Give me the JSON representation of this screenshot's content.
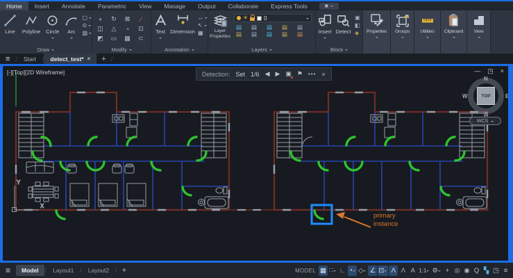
{
  "colors": {
    "accent": "#1b6ee8",
    "hl": "#1f8cff",
    "green": "#2fc32f",
    "wall": "#6e2e26",
    "blue": "#2744ae",
    "orange": "#d9782a",
    "gray": "#98a0a9"
  },
  "menu": {
    "tabs": [
      {
        "name": "tab-home",
        "label": "Home",
        "active": true
      },
      {
        "name": "tab-insert",
        "label": "Insert"
      },
      {
        "name": "tab-annotate",
        "label": "Annotate"
      },
      {
        "name": "tab-parametric",
        "label": "Parametric"
      },
      {
        "name": "tab-view",
        "label": "View"
      },
      {
        "name": "tab-manage",
        "label": "Manage"
      },
      {
        "name": "tab-output",
        "label": "Output"
      },
      {
        "name": "tab-collaborate",
        "label": "Collaborate"
      },
      {
        "name": "tab-express-tools",
        "label": "Express Tools"
      }
    ]
  },
  "ribbon": {
    "draw": {
      "label": "Draw",
      "line": "Line",
      "polyline": "Polyline",
      "circle": "Circle",
      "arc": "Arc",
      "small_icons": [
        {
          "name": "rectangle-tool-icon",
          "glyph": "▢",
          "caret": true
        },
        {
          "name": "ellipse-tool-icon",
          "glyph": "⊙",
          "caret": true
        },
        {
          "name": "hatch-tool-icon",
          "glyph": "▨",
          "caret": true
        }
      ]
    },
    "modify": {
      "label": "Modify",
      "grid": [
        {
          "name": "move-icon",
          "glyph": "+"
        },
        {
          "name": "rotate-icon",
          "glyph": "↻"
        },
        {
          "name": "trim-icon",
          "glyph": "⊠"
        },
        {
          "name": "erase-icon",
          "glyph": "∕",
          "color": "#e06a6a"
        },
        {
          "name": "copy-icon",
          "glyph": "◫"
        },
        {
          "name": "mirror-icon",
          "glyph": "△"
        },
        {
          "name": "fillet-icon",
          "glyph": "◔"
        },
        {
          "name": "explode-icon",
          "glyph": "⊡"
        },
        {
          "name": "stretch-icon",
          "glyph": "◩"
        },
        {
          "name": "scale-icon",
          "glyph": "▭"
        },
        {
          "name": "array-icon",
          "glyph": "▦"
        },
        {
          "name": "offset-icon",
          "glyph": "⊂"
        }
      ]
    },
    "annotation": {
      "label": "Annotation",
      "text": "Text",
      "dimension": "Dimension",
      "side_icons": [
        {
          "name": "dim-linear-icon",
          "glyph": "↔",
          "caret": true
        },
        {
          "name": "leader-icon",
          "glyph": "↖",
          "caret": true
        },
        {
          "name": "table-icon",
          "glyph": "▦"
        }
      ]
    },
    "layers": {
      "label": "Layers",
      "layer_properties_1": "Layer",
      "layer_properties_2": "Properties",
      "current_layer": "0",
      "grid": [
        {
          "name": "layer-state-icon",
          "glyph": "▤",
          "color": "#53b7dc"
        },
        {
          "name": "layer-state-icon",
          "glyph": "▤",
          "color": "#9fb3c8"
        },
        {
          "name": "layer-state-icon",
          "glyph": "▤",
          "color": "#53b7dc"
        },
        {
          "name": "layer-state-icon",
          "glyph": "▤",
          "color": "#cbb25a"
        },
        {
          "name": "layer-state-icon",
          "glyph": "▤",
          "color": "#9fb3c8"
        },
        {
          "name": "layer-state-icon",
          "glyph": "▤",
          "color": "#cbb25a"
        },
        {
          "name": "layer-state-icon",
          "glyph": "▤",
          "color": "#9fb3c8"
        },
        {
          "name": "layer-state-icon",
          "glyph": "▤",
          "color": "#53b7dc"
        },
        {
          "name": "layer-state-icon",
          "glyph": "▤",
          "color": "#cbb25a"
        },
        {
          "name": "layer-state-icon",
          "glyph": "▤",
          "color": "#d98a5a"
        }
      ]
    },
    "block": {
      "label": "Block",
      "insert": "Insert",
      "detect": "Detect",
      "side_icons": [
        {
          "name": "block-create-icon",
          "glyph": "▣",
          "color": "#9fb3c8"
        },
        {
          "name": "block-attributes-icon",
          "glyph": "◧",
          "color": "#9fb3c8"
        },
        {
          "name": "block-sync-icon",
          "glyph": "◈",
          "color": "#cbb25a"
        }
      ]
    },
    "single_panels_labels": {
      "properties": "Properties",
      "groups": "Groups",
      "utilities": "Utilities",
      "clipboard": "Clipboard",
      "view": "View"
    }
  },
  "file_tabs": {
    "start": "Start",
    "document": "detect_test*"
  },
  "viewport": {
    "label": "[-][Top][2D Wireframe]",
    "detection": {
      "title": "Detection:",
      "set": "Set",
      "count": "1/6"
    },
    "viewcube": {
      "n": "N",
      "w": "W",
      "e": "E",
      "s": "S",
      "top": "TOP",
      "wcs": "WCS"
    },
    "callout": {
      "line1": "primary",
      "line2": "instance"
    },
    "ucs": {
      "x": "X",
      "y": "Y"
    }
  },
  "layout_tabs": {
    "model": "Model",
    "layout1": "Layout1",
    "layout2": "Layout2"
  },
  "status": {
    "model": "MODEL",
    "icons": [
      {
        "name": "grid-display-icon",
        "glyph": "▦",
        "active": true
      },
      {
        "name": "snap-mode-icon",
        "glyph": "∷",
        "caret": true
      },
      {
        "name": "ortho-mode-icon",
        "glyph": "∟"
      },
      {
        "name": "polar-tracking-icon",
        "glyph": "◔",
        "active": true,
        "caret": true
      },
      {
        "name": "isodraft-icon",
        "glyph": "◇",
        "caret": true
      },
      {
        "name": "object-snap-tracking-icon",
        "glyph": "∠",
        "active": true
      },
      {
        "name": "object-snap-icon",
        "glyph": "⊡",
        "active": true,
        "caret": true
      },
      {
        "name": "annotation-visibility-icon",
        "glyph": "Λ",
        "active": true
      },
      {
        "name": "annotation-autoscale-icon",
        "glyph": "Λ"
      },
      {
        "name": "annotation-scale-icon",
        "glyph": "A"
      },
      {
        "name": "viewport-scale",
        "glyph": "1:1",
        "caret": true,
        "wide": true
      },
      {
        "name": "settings-gear-icon",
        "glyph": "⚙",
        "caret": true
      },
      {
        "name": "crosshair-icon",
        "glyph": "+"
      },
      {
        "name": "isolate-objects-icon",
        "glyph": "◎"
      },
      {
        "name": "graphics-performance-icon",
        "glyph": "◉"
      },
      {
        "name": "zoom-search-icon",
        "glyph": "Q"
      },
      {
        "name": "clean-screen-icon",
        "glyph": "▚",
        "color": "#56b2d8"
      },
      {
        "name": "floating-window-icon",
        "glyph": "◳"
      },
      {
        "name": "customize-icon",
        "glyph": "≡"
      }
    ]
  },
  "icons": {
    "hamburger": "≡",
    "close": "×",
    "add": "+",
    "minimize": "—",
    "restore": "◳",
    "prev": "◀",
    "next": "▶",
    "ellipsis": "•••",
    "flag": "⚑",
    "select_similar": "▣",
    "slash": "/"
  }
}
